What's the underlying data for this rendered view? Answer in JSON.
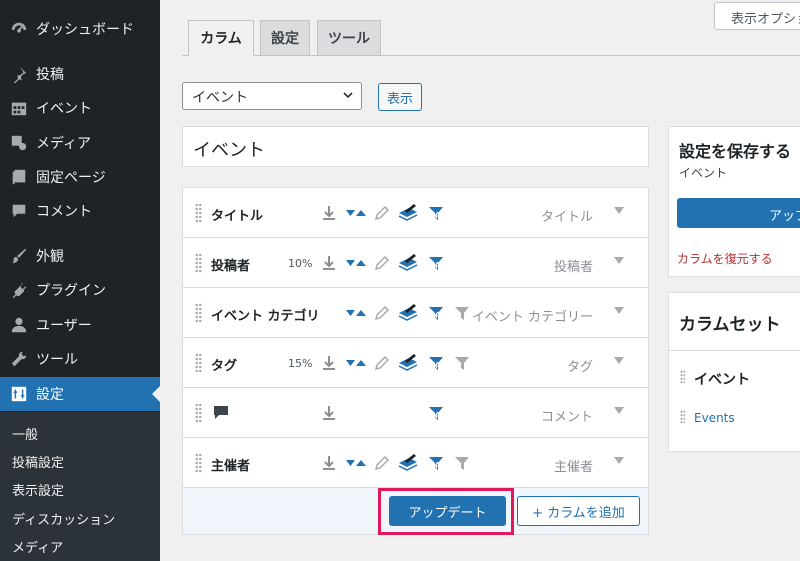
{
  "sidebar": {
    "items": [
      {
        "label": "ダッシュボード",
        "icon": "dashboard-icon"
      },
      {
        "label": "投稿",
        "icon": "pin-icon"
      },
      {
        "label": "イベント",
        "icon": "calendar-icon"
      },
      {
        "label": "メディア",
        "icon": "media-icon"
      },
      {
        "label": "固定ページ",
        "icon": "page-icon"
      },
      {
        "label": "コメント",
        "icon": "comment-icon"
      },
      {
        "label": "外観",
        "icon": "brush-icon"
      },
      {
        "label": "プラグイン",
        "icon": "plugin-icon"
      },
      {
        "label": "ユーザー",
        "icon": "user-icon"
      },
      {
        "label": "ツール",
        "icon": "wrench-icon"
      },
      {
        "label": "設定",
        "icon": "settings-icon"
      }
    ],
    "submenu": [
      "一般",
      "投稿設定",
      "表示設定",
      "ディスカッション",
      "メディア"
    ]
  },
  "screen_options": "表示オプション",
  "tabs": [
    "カラム",
    "設定",
    "ツール"
  ],
  "posttype_select": {
    "value": "イベント"
  },
  "show_button": "表示",
  "title_field": "イベント",
  "columns": [
    {
      "label": "タイトル",
      "width": "",
      "type": "タイトル"
    },
    {
      "label": "投稿者",
      "width": "10%",
      "type": "投稿者"
    },
    {
      "label": "イベント カテゴリー",
      "width": "",
      "type": "イベント カテゴリー"
    },
    {
      "label": "タグ",
      "width": "15%",
      "type": "タグ"
    },
    {
      "label": "",
      "width": "",
      "type": "コメント"
    },
    {
      "label": "主催者",
      "width": "",
      "type": "主催者"
    }
  ],
  "update_button": "アップデート",
  "add_column_button": "+ カラムを追加",
  "save_panel": {
    "title": "設定を保存する",
    "subtitle": "イベント",
    "button": "アップデート",
    "restore_link": "カラムを復元する"
  },
  "sets_panel": {
    "title": "カラムセット",
    "set_name": "イベント",
    "set_link": "Events"
  },
  "colors": {
    "accent": "#2271b1",
    "sidebar": "#1d2327",
    "highlight": "#e0195a"
  }
}
